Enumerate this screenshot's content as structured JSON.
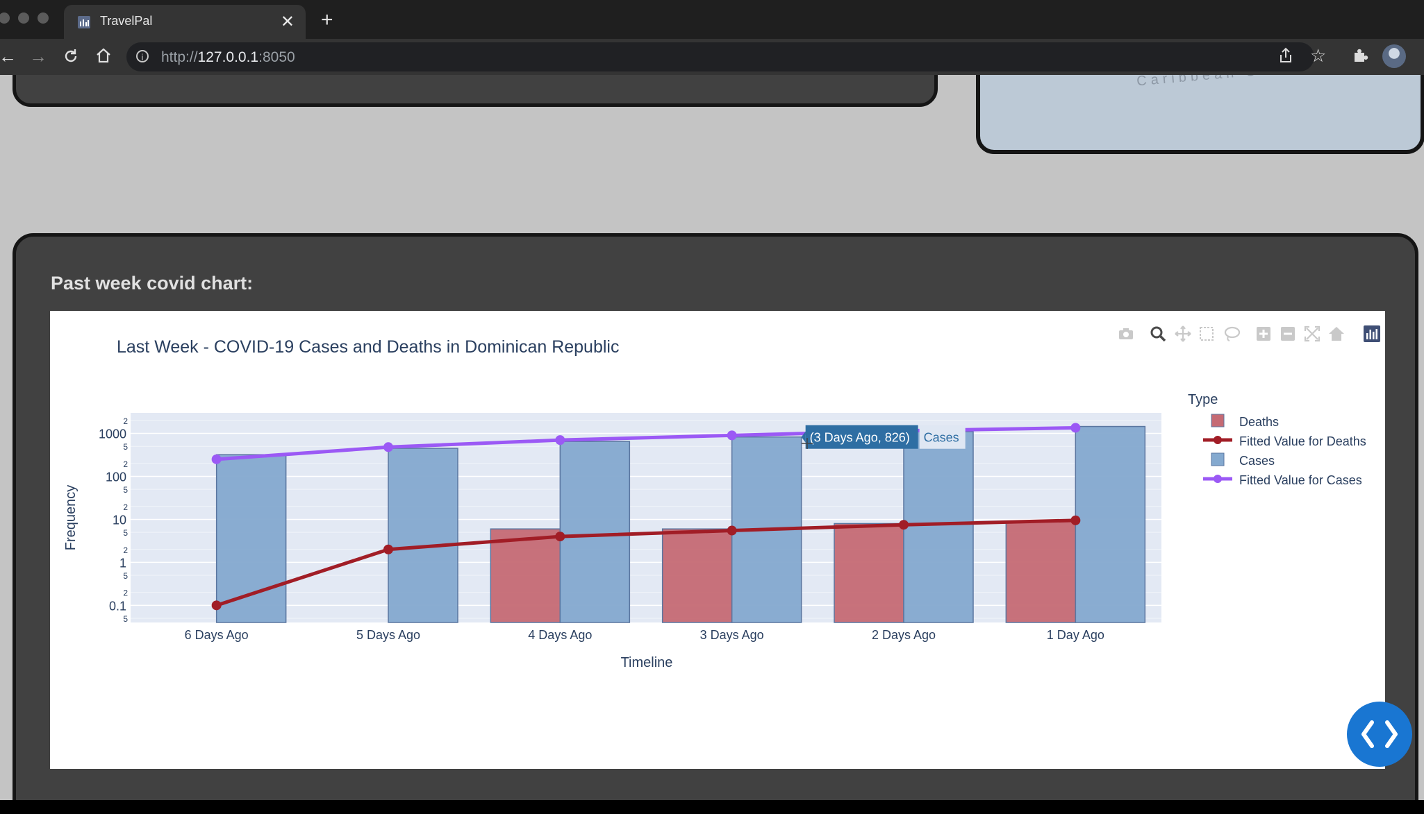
{
  "browser": {
    "tab_title": "TravelPal",
    "tab_close": "✕",
    "new_tab": "+",
    "url_prefix": "http://",
    "url_host": "127.0.0.1",
    "url_port": ":8050"
  },
  "top_map": {
    "label": "Caribbean Se"
  },
  "section": {
    "heading": "Past week covid chart:"
  },
  "chart_data": {
    "type": "bar",
    "title": "Last Week - COVID-19 Cases and Deaths in Dominican Republic",
    "xlabel": "Timeline",
    "ylabel": "Frequency",
    "yscale": "log",
    "ylim": [
      0.04,
      3000
    ],
    "categories": [
      "6 Days Ago",
      "5 Days Ago",
      "4 Days Ago",
      "3 Days Ago",
      "2 Days Ago",
      "1 Day Ago"
    ],
    "y_major_ticks": [
      {
        "value": 0.1,
        "label": "0.1"
      },
      {
        "value": 1,
        "label": "1"
      },
      {
        "value": 10,
        "label": "10"
      },
      {
        "value": 100,
        "label": "100"
      },
      {
        "value": 1000,
        "label": "1000"
      }
    ],
    "y_minor_ticks": [
      {
        "value": 0.05,
        "label": "5"
      },
      {
        "value": 0.2,
        "label": "2"
      },
      {
        "value": 0.5,
        "label": "5"
      },
      {
        "value": 2,
        "label": "2"
      },
      {
        "value": 5,
        "label": "5"
      },
      {
        "value": 20,
        "label": "2"
      },
      {
        "value": 50,
        "label": "5"
      },
      {
        "value": 200,
        "label": "2"
      },
      {
        "value": 500,
        "label": "5"
      },
      {
        "value": 2000,
        "label": "2"
      }
    ],
    "legend": {
      "title": "Type",
      "position": "right"
    },
    "series": [
      {
        "name": "Deaths",
        "kind": "bar",
        "color": "#c56a74",
        "values": [
          null,
          null,
          6,
          6,
          8,
          9
        ]
      },
      {
        "name": "Fitted Value for Deaths",
        "kind": "line",
        "color": "#a11d26",
        "values": [
          0.1,
          2,
          4,
          5.5,
          7.5,
          9.5
        ]
      },
      {
        "name": "Cases",
        "kind": "bar",
        "color": "#84a9cf",
        "values": [
          320,
          450,
          650,
          826,
          1100,
          1450
        ]
      },
      {
        "name": "Fitted Value for Cases",
        "kind": "line",
        "color": "#9b59f5",
        "values": [
          250,
          480,
          700,
          900,
          1150,
          1350
        ]
      }
    ],
    "hover": {
      "text": "(3 Days Ago, 826)",
      "series": "Cases"
    },
    "grid": true
  }
}
